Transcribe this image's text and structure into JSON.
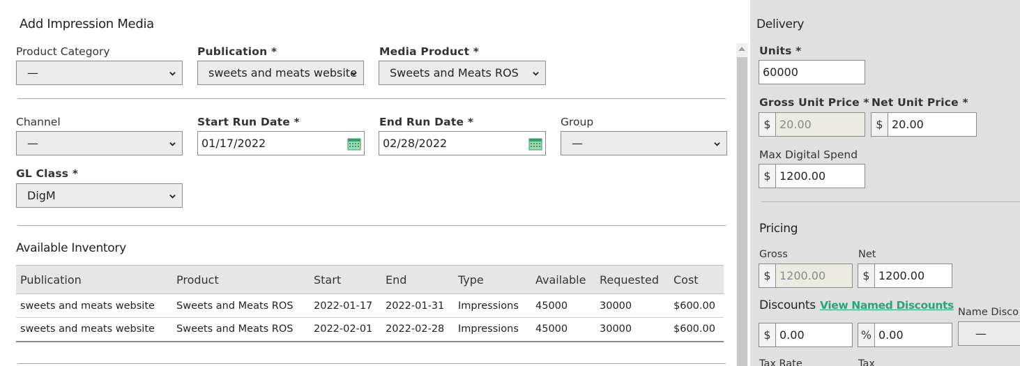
{
  "dialog": {
    "title": "Add Impression Media"
  },
  "form": {
    "product_category": {
      "label": "Product Category",
      "value": "—"
    },
    "publication": {
      "label": "Publication *",
      "value": "sweets and meats website"
    },
    "media_product": {
      "label": "Media Product *",
      "value": "Sweets and Meats ROS"
    },
    "channel": {
      "label": "Channel",
      "value": "—"
    },
    "start_run_date": {
      "label": "Start Run Date *",
      "value": "01/17/2022"
    },
    "end_run_date": {
      "label": "End Run Date *",
      "value": "02/28/2022"
    },
    "group": {
      "label": "Group",
      "value": "—"
    },
    "gl_class": {
      "label": "GL Class *",
      "value": "DigM"
    }
  },
  "inventory": {
    "title": "Available Inventory",
    "columns": [
      "Publication",
      "Product",
      "Start",
      "End",
      "Type",
      "Available",
      "Requested",
      "Cost"
    ],
    "rows": [
      [
        "sweets and meats website",
        "Sweets and Meats ROS",
        "2022-01-17",
        "2022-01-31",
        "Impressions",
        "45000",
        "30000",
        "$600.00"
      ],
      [
        "sweets and meats website",
        "Sweets and Meats ROS",
        "2022-02-01",
        "2022-02-28",
        "Impressions",
        "45000",
        "30000",
        "$600.00"
      ]
    ]
  },
  "delivery": {
    "title": "Delivery",
    "units": {
      "label": "Units *",
      "value": "60000"
    },
    "gross_unit_price": {
      "label": "Gross Unit Price *",
      "prefix": "$",
      "value": "20.00"
    },
    "net_unit_price": {
      "label": "Net Unit Price *",
      "prefix": "$",
      "value": "20.00"
    },
    "max_digital_spend": {
      "label": "Max Digital Spend",
      "prefix": "$",
      "value": "1200.00"
    }
  },
  "pricing": {
    "title": "Pricing",
    "gross": {
      "label": "Gross",
      "prefix": "$",
      "value": "1200.00"
    },
    "net": {
      "label": "Net",
      "prefix": "$",
      "value": "1200.00"
    }
  },
  "discounts": {
    "title": "Discounts",
    "link": "View Named Discounts",
    "amount": {
      "prefix": "$",
      "value": "0.00"
    },
    "percent": {
      "prefix": "%",
      "value": "0.00"
    },
    "named_label": "Name Disco",
    "named_value": "—"
  },
  "tax": {
    "rate_label": "Tax Rate",
    "tax_label": "Tax"
  },
  "colors": {
    "accent": "#2aa37a",
    "panel": "#e0e0e0"
  }
}
